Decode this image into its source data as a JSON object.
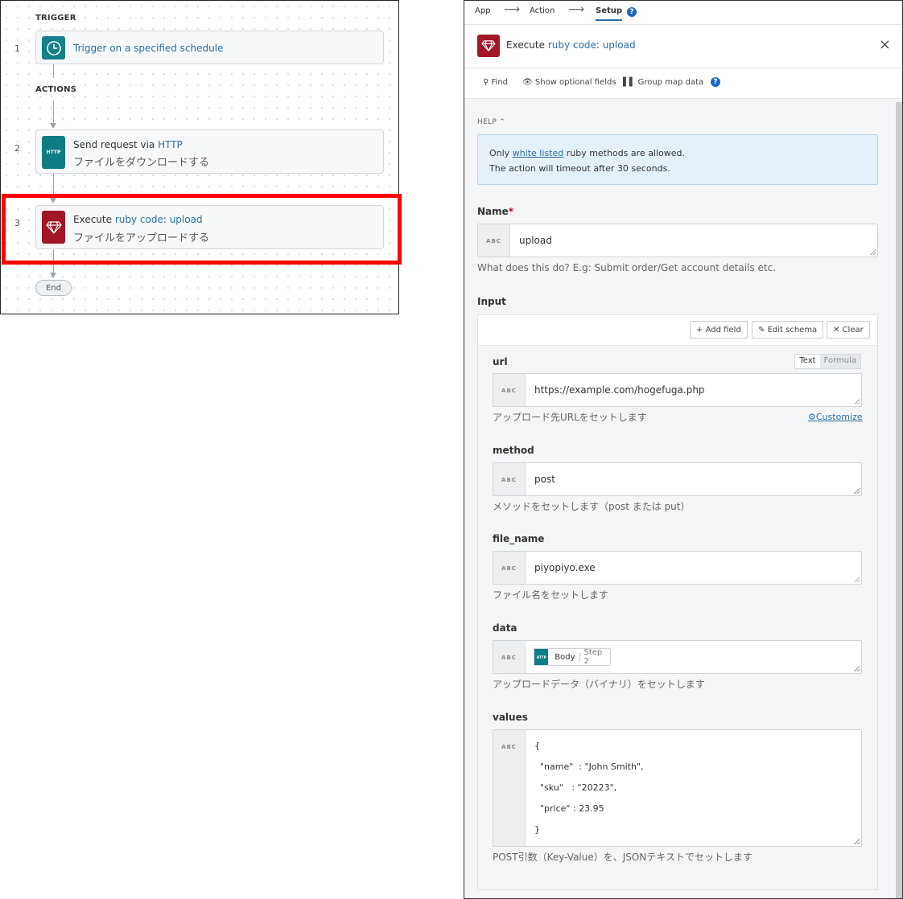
{
  "flow": {
    "trigger_label": "TRIGGER",
    "actions_label": "ACTIONS",
    "steps": [
      {
        "num": "1",
        "title": "Trigger on a specified schedule",
        "icon": "clock-icon",
        "color": "#138189"
      },
      {
        "num": "2",
        "title_prefix": "Send request via ",
        "title_app": "HTTP",
        "subtitle": "ファイルをダウンロードする",
        "icon_text": "HTTP",
        "color": "#0e7c86"
      },
      {
        "num": "3",
        "title_prefix": "Execute ",
        "title_app": "ruby code",
        "title_sep": ": ",
        "title_action": "upload",
        "subtitle": "ファイルをアップロードする",
        "icon": "ruby-gem-icon",
        "color": "#a21628"
      }
    ],
    "end_label": "End",
    "highlight_color": "#ff0000"
  },
  "panel": {
    "crumbs": [
      "App",
      "Action",
      "Setup"
    ],
    "crumb_arrow": "⟶",
    "help_glyph": "?",
    "header": {
      "prefix": "Execute ",
      "app": "ruby code",
      "sep": ": ",
      "action": "upload",
      "close": "×"
    },
    "toolbar": {
      "find": "Find",
      "optional": "Show optional fields",
      "group": "Group map data"
    },
    "help": {
      "toggle": "HELP",
      "line1_a": "Only ",
      "line1_link": "white listed",
      "line1_b": " ruby methods are allowed.",
      "line2": "The action will timeout after 30 seconds."
    },
    "abc": "ABC",
    "name": {
      "label": "Name",
      "required": "*",
      "value": "upload",
      "hint": "What does this do? E.g: Submit order/Get account details etc."
    },
    "input": {
      "label": "Input",
      "add_field": "Add field",
      "edit_schema": "Edit schema",
      "clear": "Clear",
      "mode_text": "Text",
      "mode_formula": "Formula",
      "customize": "Customize",
      "fields": {
        "url": {
          "label": "url",
          "value": "https://example.com/hogefuga.php",
          "hint": "アップロード先URLをセットします"
        },
        "method": {
          "label": "method",
          "value": "post",
          "hint": "メソッドをセットします（post または put）"
        },
        "file_name": {
          "label": "file_name",
          "value": "piyopiyo.exe",
          "hint": "ファイル名をセットします"
        },
        "data": {
          "label": "data",
          "pill_icon": "HTTP",
          "pill_field": "Body",
          "pill_step": "Step 2",
          "hint": "アップロードデータ（バイナリ）をセットします"
        },
        "values": {
          "label": "values",
          "lines": [
            "{",
            "  \"name\"  : \"John Smith\",",
            "  \"sku\"   : \"20223\",",
            "  \"price\" : 23.95",
            "}"
          ],
          "hint": "POST引数（Key-Value）を、JSONテキストでセットします"
        }
      }
    }
  }
}
